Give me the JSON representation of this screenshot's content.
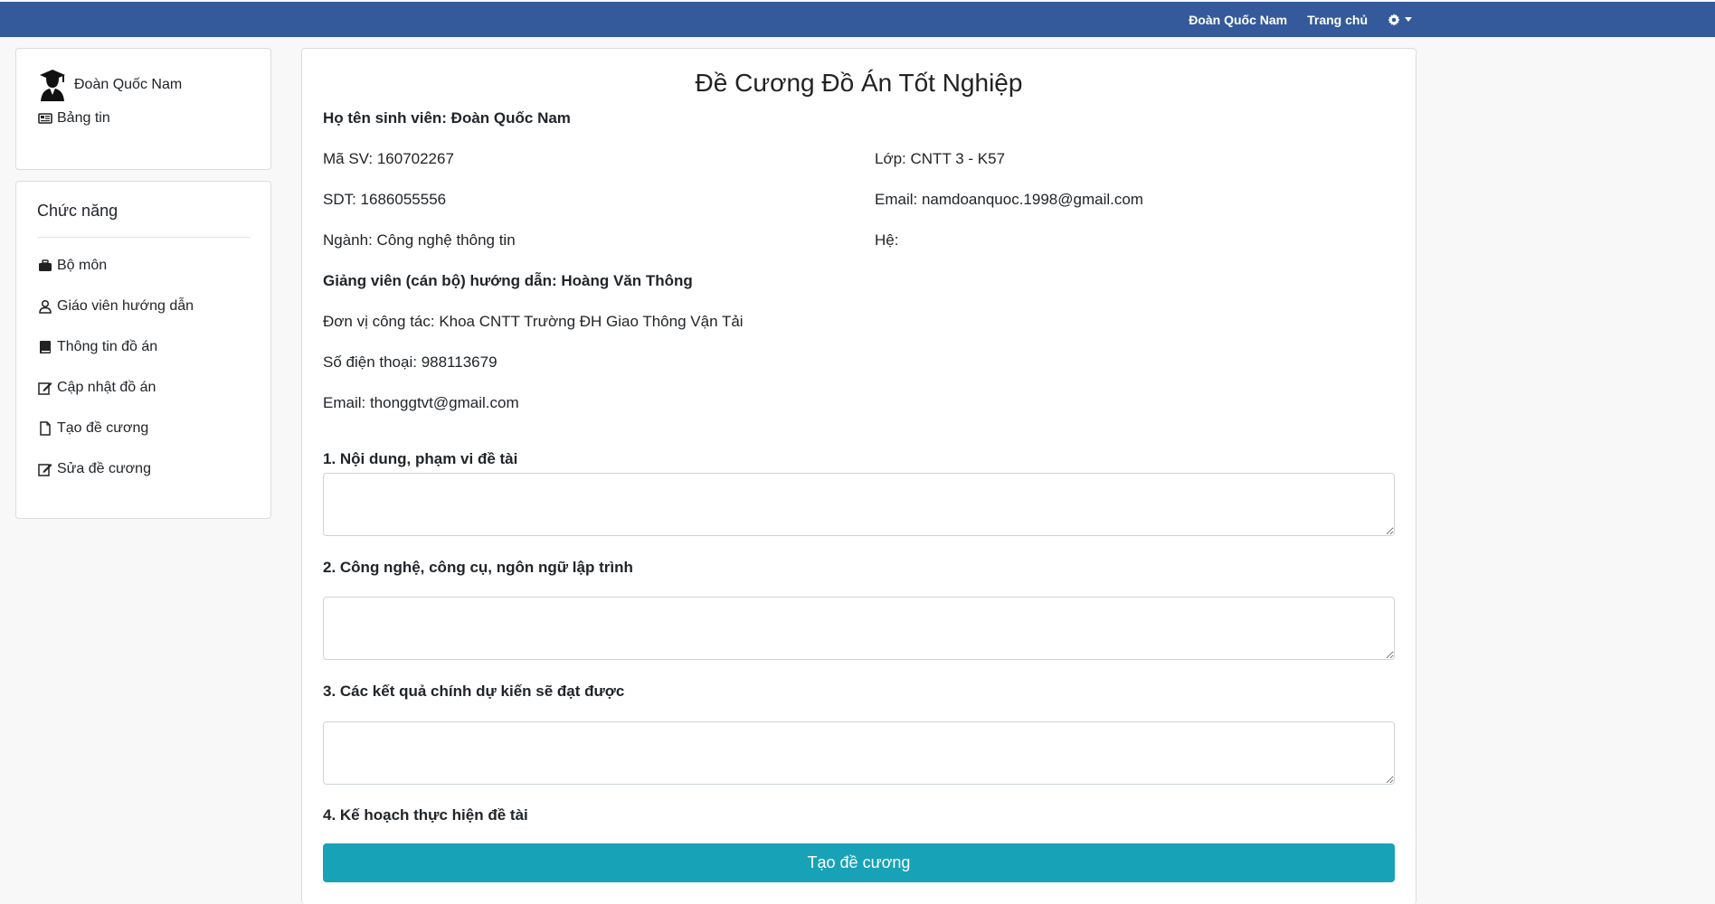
{
  "topbar": {
    "user_link": "Đoàn Quốc Nam",
    "home_link": "Trang chủ",
    "settings_icon": "gear-icon",
    "color": "#345a9b"
  },
  "sidebar": {
    "user_name": "Đoàn Quốc Nam",
    "news_label": "Bảng tin",
    "func_title": "Chức năng",
    "items": [
      {
        "label": "Bộ môn",
        "icon": "briefcase-icon"
      },
      {
        "label": "Giáo viên hướng dẫn",
        "icon": "user-icon"
      },
      {
        "label": "Thông tin đồ án",
        "icon": "book-icon"
      },
      {
        "label": "Cập nhật đồ án",
        "icon": "edit-icon"
      },
      {
        "label": "Tạo đề cương",
        "icon": "file-icon"
      },
      {
        "label": "Sửa đề cương",
        "icon": "edit-icon"
      }
    ]
  },
  "main": {
    "title": "Đề Cương Đồ Án Tốt Nghiệp",
    "student_name": "Họ tên sinh viên: Đoàn Quốc Nam",
    "student_id": "Mã SV: 160702267",
    "class": "Lớp: CNTT 3 - K57",
    "phone": "SDT: 1686055556",
    "email": "Email: namdoanquoc.1998@gmail.com",
    "major": "Ngành: Công nghệ thông tin",
    "system": "Hệ:",
    "advisor": "Giảng viên (cán bộ) hướng dẫn: Hoàng Văn Thông",
    "workplace": "Đơn vị công tác: Khoa CNTT Trường ĐH Giao Thông Vận Tải",
    "advisor_phone": "Số điện thoại: 988113679",
    "advisor_email": "Email: thonggtvt@gmail.com",
    "section1": "1. Nội dung, phạm vi đề tài",
    "section2": "2. Công nghệ, công cụ, ngôn ngữ lập trình",
    "section3": "3. Các kết quả chính dự kiến sẽ đạt được",
    "section4": "4. Kế hoạch thực hiện đề tài",
    "submit_label": "Tạo đề cương",
    "submit_color": "#17a2b8"
  }
}
